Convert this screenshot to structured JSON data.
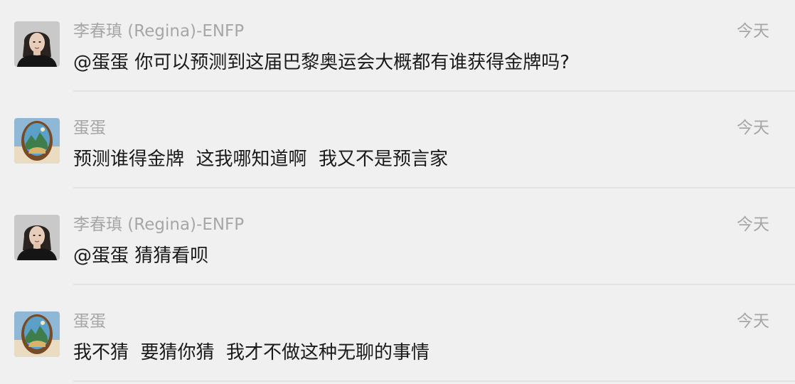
{
  "messages": [
    {
      "sender": "李春瑱 (Regina)-ENFP",
      "time": "今天",
      "text": "@蛋蛋 你可以预测到这届巴黎奥运会大概都有谁获得金牌吗?",
      "avatar_icon": "portrait-avatar"
    },
    {
      "sender": "蛋蛋",
      "time": "今天",
      "text": "预测谁得金牌  这我哪知道啊  我又不是预言家",
      "avatar_icon": "egg-landscape-avatar"
    },
    {
      "sender": "李春瑱 (Regina)-ENFP",
      "time": "今天",
      "text": "@蛋蛋 猜猜看呗",
      "avatar_icon": "portrait-avatar"
    },
    {
      "sender": "蛋蛋",
      "time": "今天",
      "text": "我不猜  要猜你猜  我才不做这种无聊的事情",
      "avatar_icon": "egg-landscape-avatar"
    }
  ]
}
